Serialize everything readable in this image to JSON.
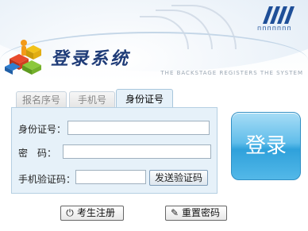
{
  "header": {
    "title": "登录系统",
    "subtitle": "THE BACKSTAGE REGISTERS THE SYSTEM",
    "logo_icon": "colored-blocks-logo-icon",
    "stripes_icon": "slanted-stripes-icon",
    "dots_text": "ппппппп"
  },
  "tabs": [
    {
      "label": "报名序号",
      "active": false
    },
    {
      "label": "手机号",
      "active": false
    },
    {
      "label": "身份证号",
      "active": true
    }
  ],
  "form": {
    "id_label": "身份证号：",
    "id_value": "",
    "password_label": "密　码：",
    "password_value": "",
    "code_label": "手机验证码：",
    "code_value": "",
    "send_code_button": "发送验证码"
  },
  "login_button": "登录",
  "footer": {
    "register_button": "考生注册",
    "register_icon": "power-icon",
    "reset_password_button": "重置密码",
    "reset_icon": "edit-icon"
  },
  "colors": {
    "accent": "#2fa1db",
    "title": "#1f3c78",
    "panel_bg": "#e6f1f9"
  }
}
